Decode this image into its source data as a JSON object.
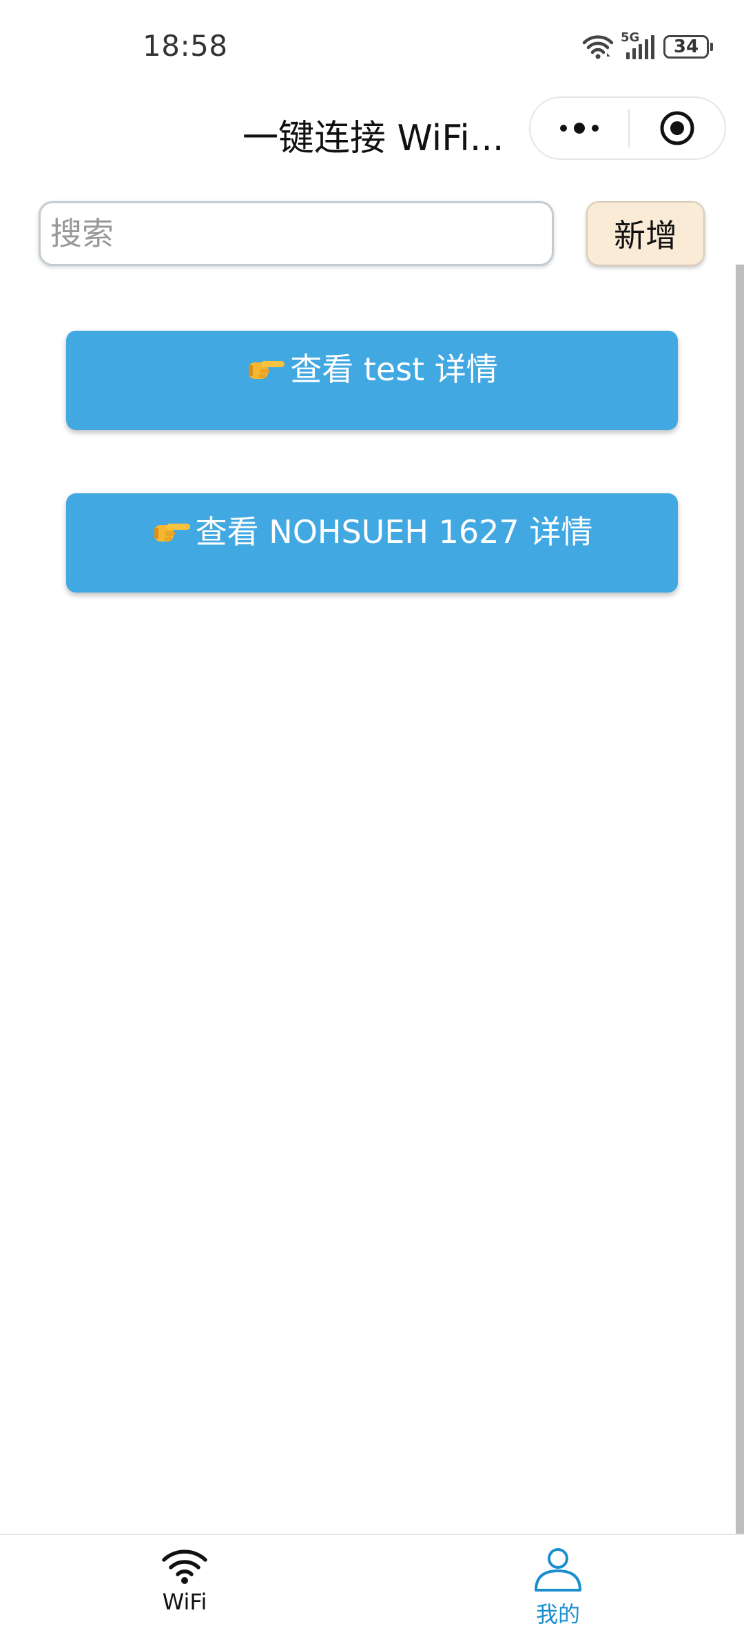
{
  "status_bar": {
    "time": "18:58",
    "network_label": "5G",
    "battery": "34"
  },
  "nav": {
    "title": "一键连接 WiFi..."
  },
  "search": {
    "placeholder": "搜索",
    "value": ""
  },
  "add_button": {
    "label": "新增"
  },
  "wifi_list": [
    {
      "label": "查看 test 详情",
      "icon": "pointing-right-hand-icon"
    },
    {
      "label": "查看 NOHSUEH 1627 详情",
      "icon": "pointing-right-hand-icon"
    }
  ],
  "tab_bar": {
    "tabs": [
      {
        "label": "WiFi",
        "icon": "wifi-icon",
        "active": false
      },
      {
        "label": "我的",
        "icon": "person-icon",
        "active": true
      }
    ]
  },
  "colors": {
    "item_button_bg": "#41a8e2",
    "add_button_bg": "#faebd7",
    "active_tab": "#1a8fd0"
  }
}
